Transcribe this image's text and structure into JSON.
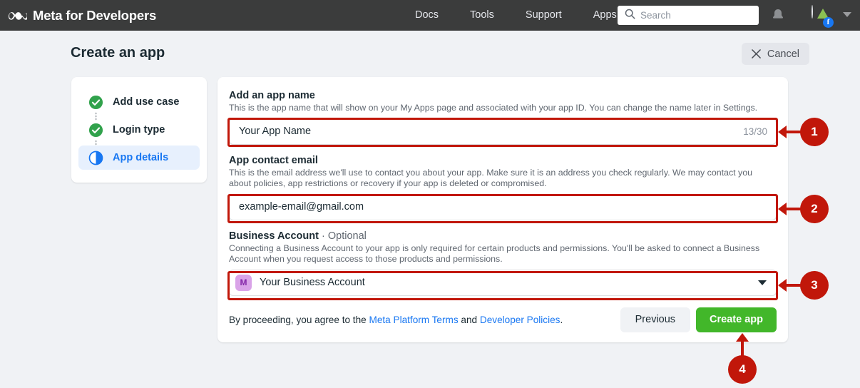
{
  "topbar": {
    "brand": "Meta for Developers",
    "logo_icon": "meta-infinity-icon",
    "nav": [
      {
        "label": "Docs"
      },
      {
        "label": "Tools"
      },
      {
        "label": "Support"
      },
      {
        "label": "Apps"
      }
    ],
    "search": {
      "placeholder": "Search",
      "value": "",
      "icon": "search-icon"
    },
    "notifications_icon": "bell-icon",
    "avatar_icon": "user-avatar",
    "avatar_badge": "f",
    "account_caret_icon": "chevron-down-icon",
    "background": "#3b3c3c"
  },
  "header": {
    "title": "Create an app",
    "cancel_label": "Cancel",
    "cancel_icon": "close-icon"
  },
  "stepper": {
    "items": [
      {
        "label": "Add use case",
        "state": "complete",
        "icon": "check-circle-icon"
      },
      {
        "label": "Login type",
        "state": "complete",
        "icon": "check-circle-icon"
      },
      {
        "label": "App details",
        "state": "current",
        "icon": "half-circle-icon"
      }
    ]
  },
  "form": {
    "app_name": {
      "title": "Add an app name",
      "description": "This is the app name that will show on your My Apps page and associated with your app ID. You can change the name later in Settings.",
      "value": "Your App Name",
      "placeholder": "Your App Name",
      "counter": "13/30"
    },
    "contact_email": {
      "title": "App contact email",
      "description": "This is the email address we'll use to contact you about your app. Make sure it is an address you check regularly. We may contact you about policies, app restrictions or recovery if your app is deleted or compromised.",
      "value": "example-email@gmail.com",
      "placeholder": "example-email@gmail.com"
    },
    "business_account": {
      "title": "Business Account",
      "optional_suffix": "· Optional",
      "description": "Connecting a Business Account to your app is only required for certain products and permissions. You'll be asked to connect a Business Account when you request access to those products and permissions.",
      "selected": "Your Business Account",
      "avatar_initial": "M",
      "avatar_color": "#d9a3e8",
      "caret_icon": "chevron-down-icon"
    }
  },
  "footer": {
    "legal_prefix": "By proceeding, you agree to the ",
    "legal_link_1": "Meta Platform Terms",
    "legal_middle": " and ",
    "legal_link_2": "Developer Policies",
    "legal_suffix": ".",
    "previous_label": "Previous",
    "create_label": "Create app",
    "create_color": "#42b72a"
  },
  "annotations": {
    "color": "#c1170a",
    "callouts": [
      {
        "number": "1",
        "target": "app-name-input"
      },
      {
        "number": "2",
        "target": "contact-email-input"
      },
      {
        "number": "3",
        "target": "business-account-select"
      },
      {
        "number": "4",
        "target": "create-app-button"
      }
    ]
  }
}
